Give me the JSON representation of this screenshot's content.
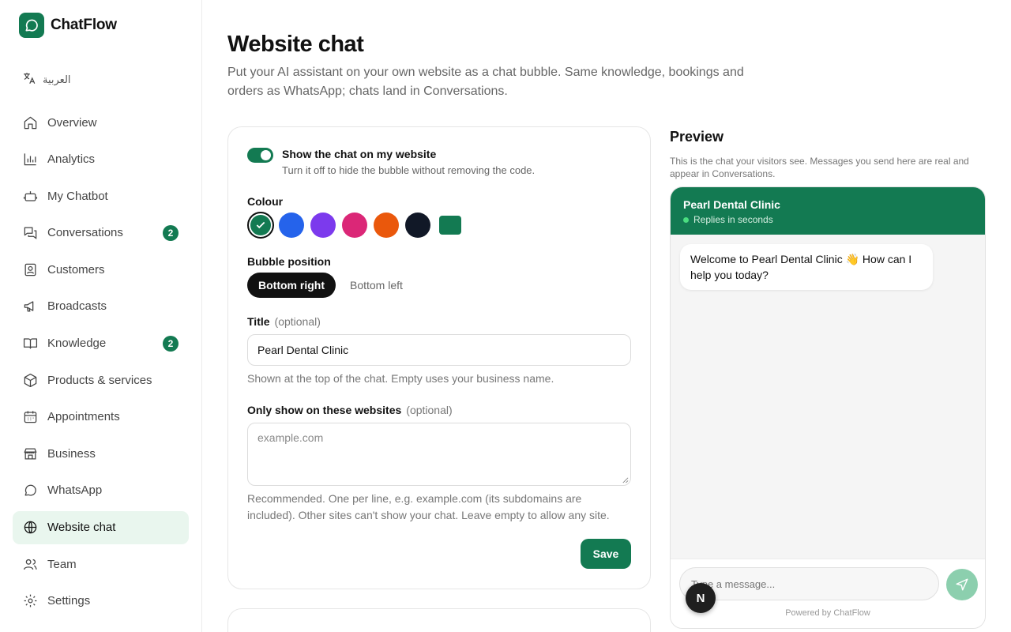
{
  "brand": {
    "name": "ChatFlow",
    "color": "#137a52",
    "icon": "chat-bubble-icon"
  },
  "language": {
    "label": "العربية",
    "icon": "translate-icon"
  },
  "sidebar": {
    "items": [
      {
        "label": "Overview",
        "icon": "home-icon"
      },
      {
        "label": "Analytics",
        "icon": "bar-chart-icon"
      },
      {
        "label": "My Chatbot",
        "icon": "bot-icon"
      },
      {
        "label": "Conversations",
        "icon": "conversations-icon",
        "badge": "2"
      },
      {
        "label": "Customers",
        "icon": "contact-icon"
      },
      {
        "label": "Broadcasts",
        "icon": "megaphone-icon"
      },
      {
        "label": "Knowledge",
        "icon": "book-icon",
        "badge": "2"
      },
      {
        "label": "Products & services",
        "icon": "box-icon"
      },
      {
        "label": "Appointments",
        "icon": "calendar-icon"
      },
      {
        "label": "Business",
        "icon": "store-icon"
      },
      {
        "label": "WhatsApp",
        "icon": "whatsapp-icon"
      },
      {
        "label": "Website chat",
        "icon": "globe-icon",
        "active": true
      },
      {
        "label": "Team",
        "icon": "team-icon"
      },
      {
        "label": "Settings",
        "icon": "gear-icon"
      }
    ]
  },
  "main": {
    "title": "Website chat",
    "description": "Put your AI assistant on your own website as a chat bubble. Same knowledge, bookings and orders as WhatsApp; chats land in Conversations."
  },
  "form": {
    "toggle": {
      "on": true,
      "label": "Show the chat on my website",
      "help": "Turn it off to hide the bubble without removing the code."
    },
    "colour": {
      "label": "Colour",
      "options": [
        "#137a52",
        "#2563eb",
        "#7c3aed",
        "#db2777",
        "#ea580c",
        "#111827",
        "#137a52"
      ],
      "selected": "#137a52"
    },
    "position": {
      "label": "Bubble position",
      "options": [
        "Bottom right",
        "Bottom left"
      ],
      "selected": "Bottom right"
    },
    "title_field": {
      "label": "Title",
      "optional": "(optional)",
      "value": "Pearl Dental Clinic",
      "help": "Shown at the top of the chat. Empty uses your business name."
    },
    "websites_field": {
      "label": "Only show on these websites",
      "optional": "(optional)",
      "placeholder": "example.com",
      "help_line1": "Recommended. One per line, e.g. example.com (its subdomains are",
      "help_line2": "included). Other sites can't show your chat. Leave empty to allow any site."
    },
    "save_label": "Save"
  },
  "preview": {
    "title": "Preview",
    "description": "This is the chat your visitors see. Messages you send here are real and appear in Conversations.",
    "header_name": "Pearl Dental Clinic",
    "header_status": "Replies in seconds",
    "welcome": "Welcome to Pearl Dental Clinic 👋 How can I help you today?",
    "input_placeholder": "Type a message...",
    "powered_by": "Powered by ChatFlow"
  },
  "overlay": {
    "badge_letter": "N"
  }
}
